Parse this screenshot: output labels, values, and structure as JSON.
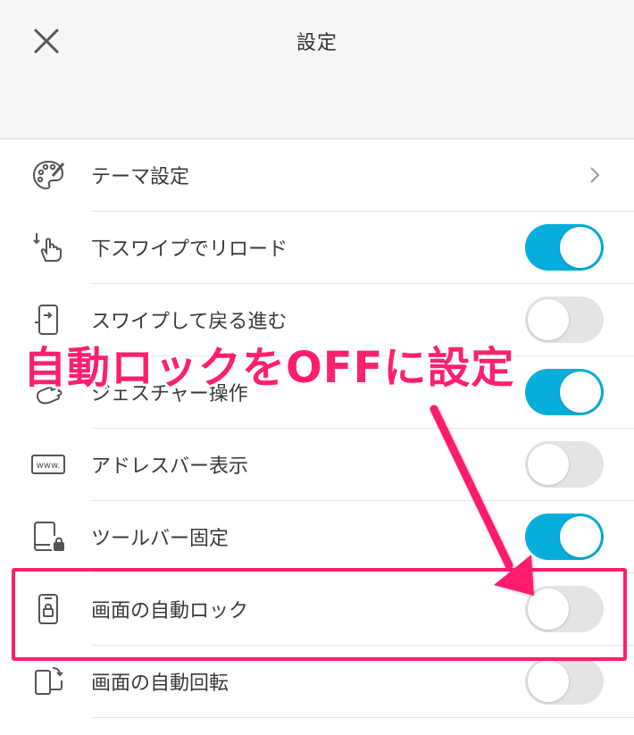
{
  "header": {
    "title": "設定"
  },
  "settings": {
    "items": [
      {
        "label": "テーマ設定",
        "icon": "palette-icon",
        "control": "chevron"
      },
      {
        "label": "下スワイプでリロード",
        "icon": "swipe-down-hand-icon",
        "control": "toggle",
        "on": true
      },
      {
        "label": "スワイプして戻る進む",
        "icon": "swipe-page-icon",
        "control": "toggle",
        "on": false
      },
      {
        "label": "ジェスチャー操作",
        "icon": "gesture-hand-icon",
        "control": "toggle",
        "on": true
      },
      {
        "label": "アドレスバー表示",
        "icon": "www-address-icon",
        "control": "toggle",
        "on": false
      },
      {
        "label": "ツールバー固定",
        "icon": "toolbar-lock-icon",
        "control": "toggle",
        "on": true
      },
      {
        "label": "画面の自動ロック",
        "icon": "screen-lock-icon",
        "control": "toggle",
        "on": false
      },
      {
        "label": "画面の自動回転",
        "icon": "screen-rotate-icon",
        "control": "toggle",
        "on": false
      }
    ]
  },
  "annotation": {
    "text": "自動ロックをOFFに設定"
  },
  "colors": {
    "accent": "#08aedb",
    "annotation": "#ff1f6e",
    "toggle_off": "#e4e4e4"
  }
}
